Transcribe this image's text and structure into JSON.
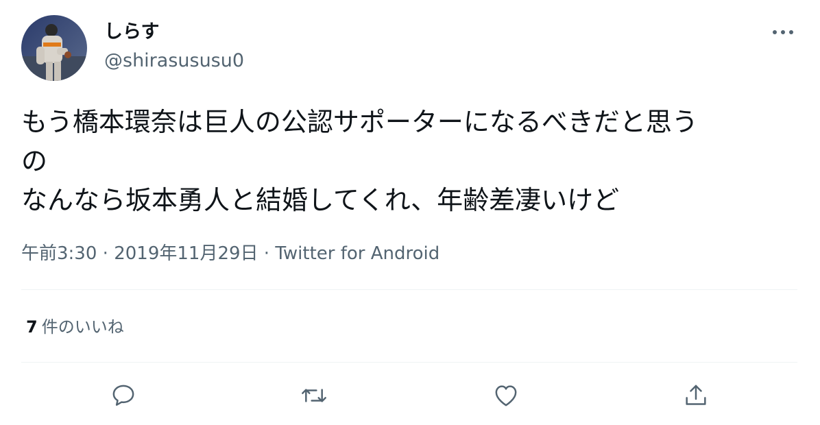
{
  "author": {
    "display_name": "しらす",
    "handle": "@shirasususu0"
  },
  "tweet": {
    "text": "もう橋本環奈は巨人の公認サポーターになるべきだと思う\nの\nなんなら坂本勇人と結婚してくれ、年齢差凄いけど",
    "time": "午前3:30",
    "date": "2019年11月29日",
    "separator": " · ",
    "source": "Twitter for Android"
  },
  "stats": {
    "like_count": "7",
    "like_label": "件のいいね"
  },
  "actions": [
    {
      "name": "reply",
      "icon": "speech-bubble-icon"
    },
    {
      "name": "retweet",
      "icon": "retweet-arrows-icon"
    },
    {
      "name": "like",
      "icon": "heart-icon"
    },
    {
      "name": "share",
      "icon": "share-upload-icon"
    }
  ],
  "colors": {
    "text_primary": "#0f1419",
    "text_secondary": "#536471",
    "divider": "#eff3f4"
  }
}
